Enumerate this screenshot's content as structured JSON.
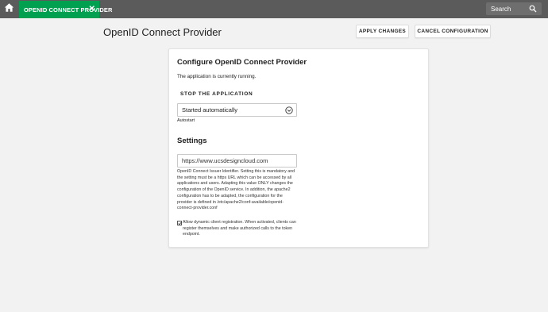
{
  "topbar": {
    "home_icon": "home-icon",
    "tab_label": "OPENID CONNECT PROVIDER",
    "tab_close": "✕",
    "search_placeholder": "Search",
    "search_icon": "search-icon",
    "accent_color": "#00a051"
  },
  "header": {
    "title": "OpenID Connect Provider",
    "apply_label": "APPLY CHANGES",
    "cancel_label": "CANCEL CONFIGURATION"
  },
  "card": {
    "title": "Configure OpenID Connect Provider",
    "status": "The application is currently running.",
    "stop_section": "STOP THE APPLICATION",
    "autostart_value": "Started automatically",
    "autostart_label": "Autostart",
    "settings_title": "Settings",
    "issuer_value": "https://www.ucsdesigncloud.com",
    "issuer_help": "OpenID Connect Issuer Identifier. Setting this is mandatory and the setting must be a https URL which can be accessed by all applications and users. Adapting this value ONLY changes the configuration of the OpenID service. In addition, the apache2 configuration has to be adapted, the configuration for the provider is defined in /etc/apache2/conf-available/openid-connect-provider.conf",
    "dynamic_registration_checked": true,
    "dynamic_registration_label": "Allow dynamic client registration. When activated, clients can register themselves and make authorized calls to the token endpoint."
  }
}
